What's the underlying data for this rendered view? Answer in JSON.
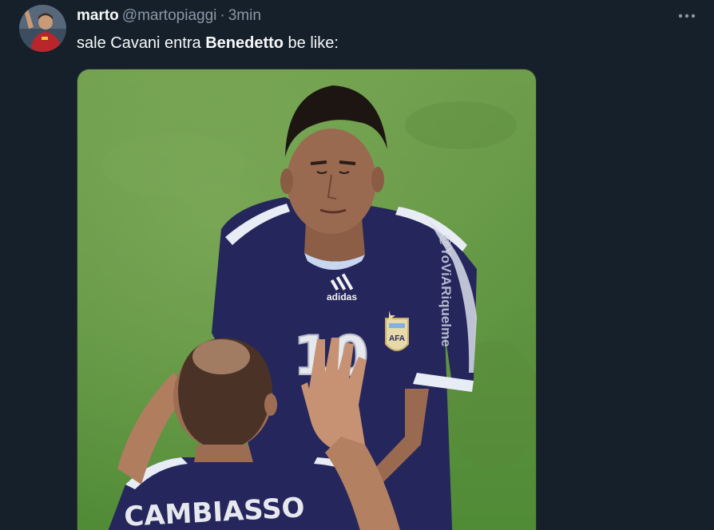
{
  "tweet": {
    "display_name": "marto",
    "handle": "@martopiaggi",
    "separator": "·",
    "time": "3min",
    "text_before": "sale Cavani entra ",
    "text_bold": "Benedetto",
    "text_after": " be like:",
    "more_icon": "more-horizontal-icon"
  },
  "media": {
    "jersey_number": "10",
    "jersey_brand": "adidas",
    "crest_text": "AFA",
    "back_name": "CAMBIASSO",
    "watermark": "@YoViARiquelme"
  },
  "colors": {
    "background": "#15202b",
    "text_primary": "#f7f9f9",
    "text_secondary": "#8b98a5",
    "grass": "#5b8f3b",
    "jersey": "#23235a"
  }
}
